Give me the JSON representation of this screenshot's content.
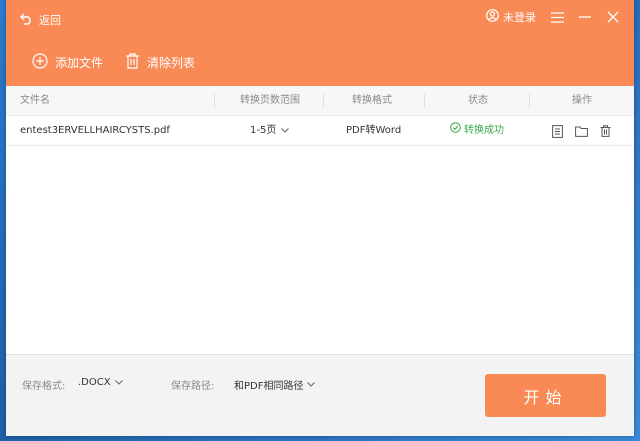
{
  "header": {
    "back_label": "返回",
    "login_label": "未登录"
  },
  "toolbar": {
    "add_label": "添加文件",
    "clear_label": "清除列表"
  },
  "table": {
    "columns": [
      "文件名",
      "转换页数范围",
      "转换格式",
      "状态",
      "操作"
    ],
    "rows": [
      {
        "filename": "entest3ERVELLHAIRCYSTS.pdf",
        "pages": "1-5页",
        "format": "PDF转Word",
        "status": "转换成功"
      }
    ]
  },
  "footer": {
    "format_label": "保存格式:",
    "format_value": ".DOCX",
    "path_label": "保存路径:",
    "path_value": "和PDF相同路径",
    "start_label": "开始"
  },
  "colors": {
    "accent": "#f98a55",
    "success": "#3fa94f"
  }
}
